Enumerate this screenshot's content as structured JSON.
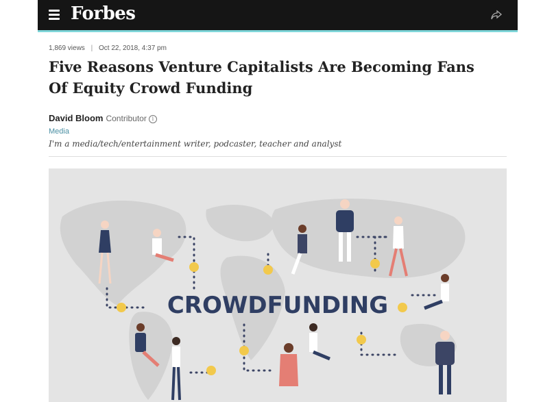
{
  "header": {
    "logo": "Forbes",
    "menu_icon": "hamburger-menu-icon",
    "share_icon": "share-arrow-icon"
  },
  "article": {
    "views": "1,869 views",
    "separator": "|",
    "date": "Oct 22, 2018, 4:37 pm",
    "title": "Five Reasons Venture Capitalists Are Becoming Fans Of Equity Crowd Funding",
    "author": {
      "name": "David Bloom",
      "role": "Contributor",
      "info_icon": "info-icon",
      "channel": "Media",
      "bio": "I'm a media/tech/entertainment writer, podcaster, teacher and analyst"
    },
    "hero_image": {
      "text": "CROWDFUNDING"
    }
  },
  "colors": {
    "topbar": "#151515",
    "accent_border": "#7fd6d9",
    "link": "#4a8fa3",
    "coin": "#f2c94c",
    "hero_text": "#2f3e63"
  }
}
